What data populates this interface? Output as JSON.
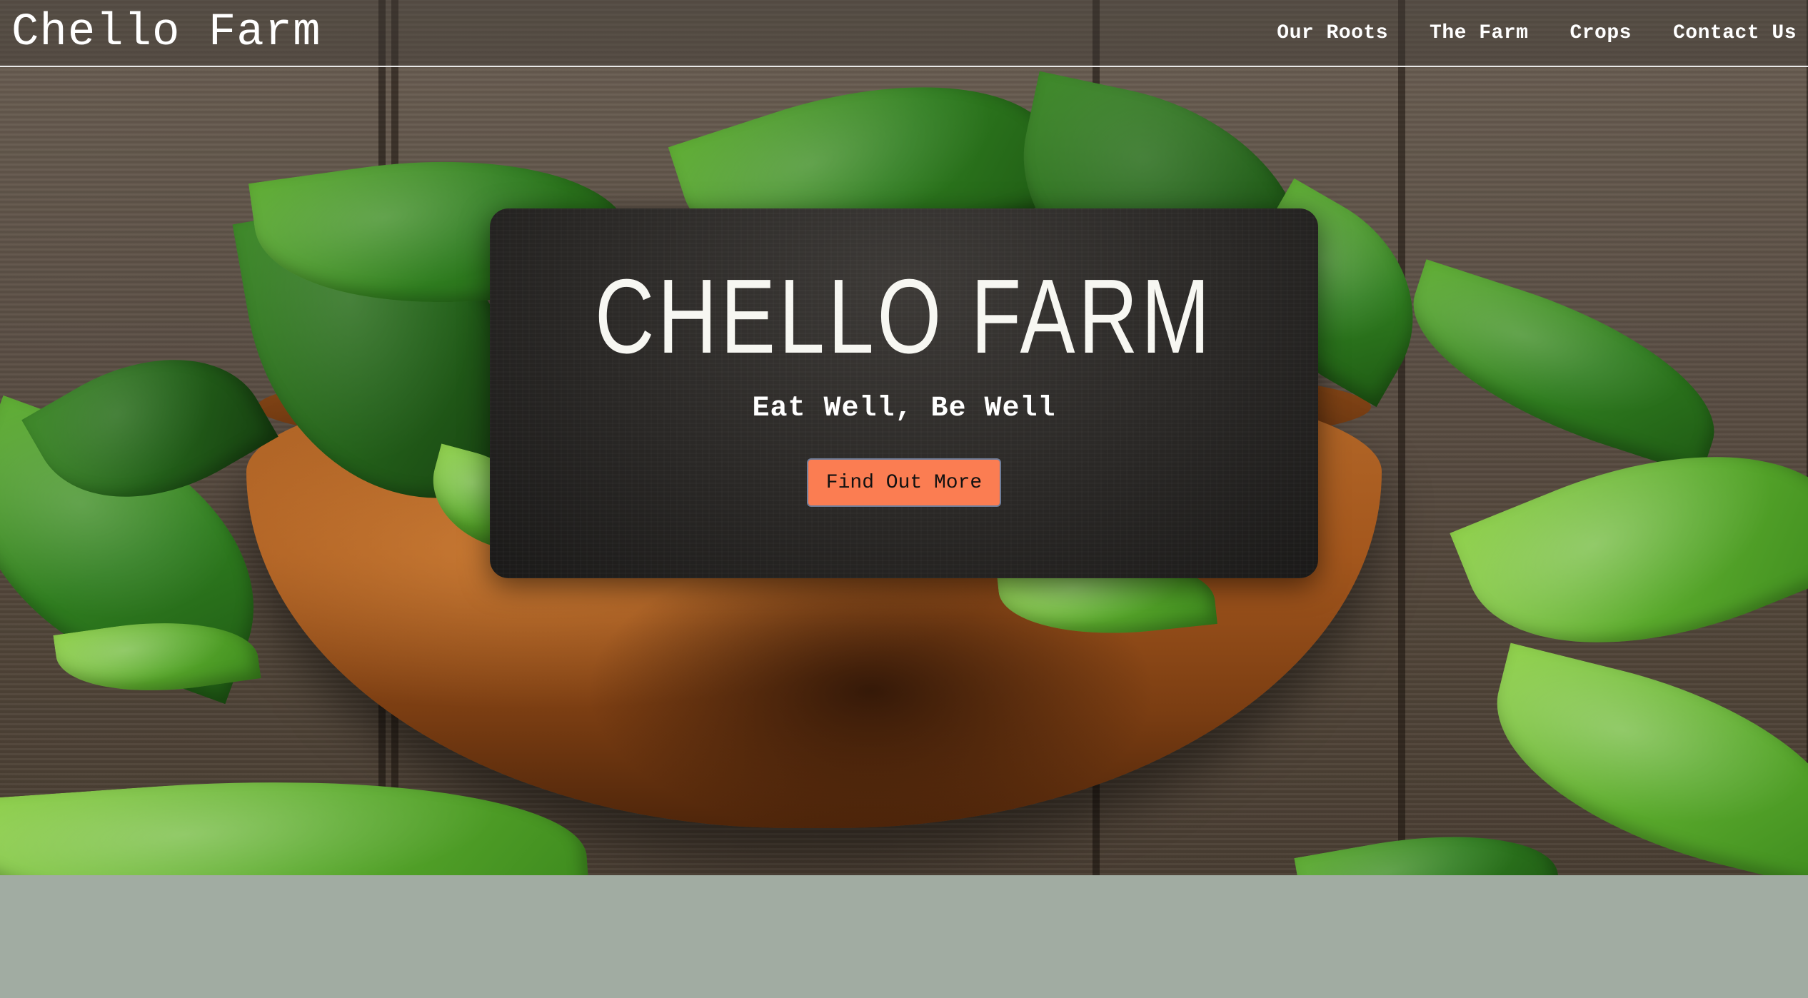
{
  "header": {
    "brand": "Chello Farm",
    "nav": [
      {
        "label": "Our Roots"
      },
      {
        "label": "The Farm"
      },
      {
        "label": "Crops"
      },
      {
        "label": "Contact Us"
      }
    ]
  },
  "hero": {
    "title": "CHELLO FARM",
    "tagline": "Eat Well, Be Well",
    "cta_label": "Find Out More",
    "background_image": "spinach-leaves-in-wooden-bowl"
  },
  "colors": {
    "cta_background": "#fb7d52",
    "page_background": "#a1aca2",
    "card_background": "#2a2826",
    "header_text": "#ffffff"
  }
}
